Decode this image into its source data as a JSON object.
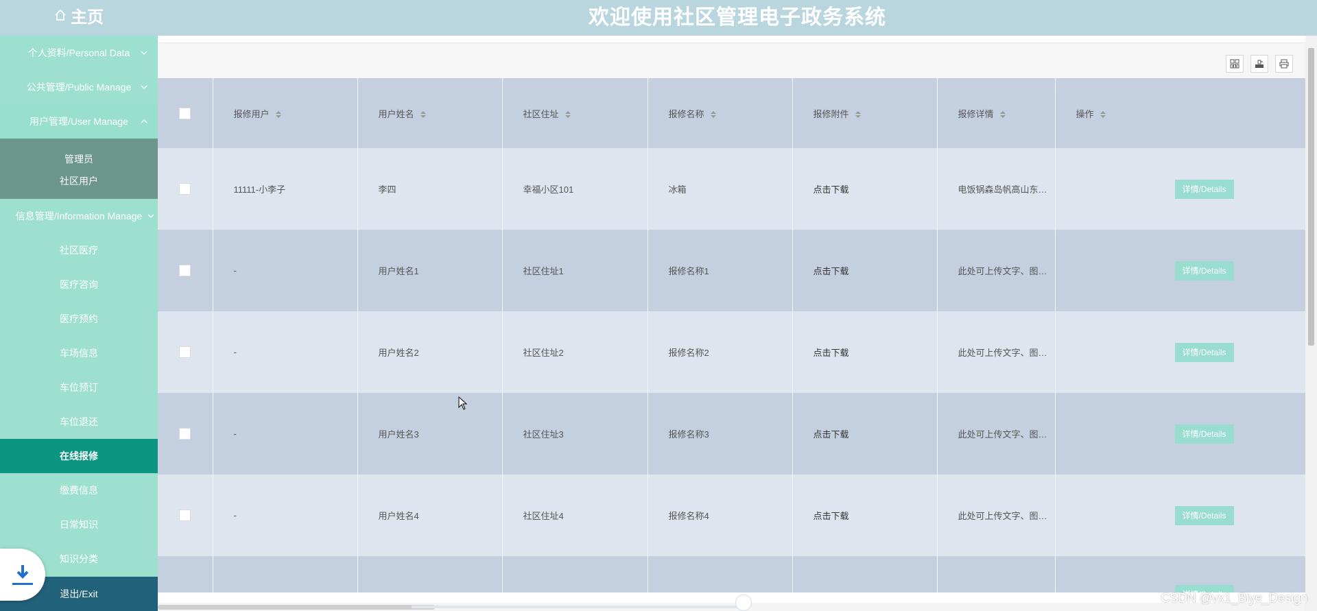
{
  "header": {
    "home_label": "主页",
    "title": "欢迎使用社区管理电子政务系统"
  },
  "sidebar": {
    "items": [
      {
        "label": "个人资料/Personal Data",
        "chevron": "down"
      },
      {
        "label": "公共管理/Public Manage",
        "chevron": "down"
      },
      {
        "label": "用户管理/User Manage",
        "chevron": "up"
      }
    ],
    "user_sub": [
      "管理员",
      "社区用户"
    ],
    "info_manage": "信息管理/Information Manage",
    "info_sub": [
      "社区医疗",
      "医疗咨询",
      "医疗预约",
      "车场信息",
      "车位预订",
      "车位退还",
      "在线报修",
      "缴费信息",
      "日常知识",
      "知识分类"
    ],
    "selected_item": "在线报修",
    "exit": "退出/Exit"
  },
  "toolbar": {
    "icons": [
      "columns-icon",
      "export-icon",
      "print-icon"
    ]
  },
  "table": {
    "headers": [
      "报修用户",
      "用户姓名",
      "社区住址",
      "报修名称",
      "报修附件",
      "报修详情",
      "操作"
    ],
    "rows": [
      {
        "user": "11111-小李子",
        "name": "李四",
        "address": "幸福小区101",
        "repair_name": "冰箱",
        "attachment": "点击下载",
        "details": "电饭锅森岛帆高山东…",
        "action": "详情/Details"
      },
      {
        "user": "-",
        "name": "用户姓名1",
        "address": "社区住址1",
        "repair_name": "报修名称1",
        "attachment": "点击下载",
        "details": "此处可上传文字、图…",
        "action": "详情/Details"
      },
      {
        "user": "-",
        "name": "用户姓名2",
        "address": "社区住址2",
        "repair_name": "报修名称2",
        "attachment": "点击下载",
        "details": "此处可上传文字、图…",
        "action": "详情/Details"
      },
      {
        "user": "-",
        "name": "用户姓名3",
        "address": "社区住址3",
        "repair_name": "报修名称3",
        "attachment": "点击下载",
        "details": "此处可上传文字、图…",
        "action": "详情/Details"
      },
      {
        "user": "-",
        "name": "用户姓名4",
        "address": "社区住址4",
        "repair_name": "报修名称4",
        "attachment": "点击下载",
        "details": "此处可上传文字、图…",
        "action": "详情/Details"
      },
      {
        "user": "",
        "name": "",
        "address": "",
        "repair_name": "",
        "attachment": "",
        "details": "",
        "action": "详情/Details"
      }
    ]
  },
  "watermark": "CSDN @vx1_Biye_Design",
  "colors": {
    "topbar": "#b9d6df",
    "sidebar": "#9ee0cf",
    "selected": "#0d9584",
    "exit": "#22617a",
    "detail_button": "#99ddd0"
  }
}
